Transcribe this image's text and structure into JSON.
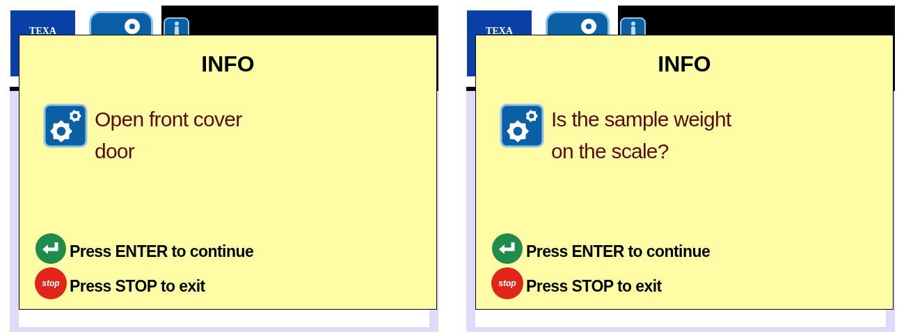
{
  "screens": [
    {
      "logo": "TEXA",
      "dialog": {
        "title": "INFO",
        "message_lines": [
          "Open front cover",
          "door"
        ],
        "hints": [
          {
            "kind": "enter",
            "text": "Press ENTER to continue"
          },
          {
            "kind": "stop",
            "icon_text": "stop",
            "text": "Press STOP to exit"
          }
        ]
      }
    },
    {
      "logo": "TEXA",
      "dialog": {
        "title": "INFO",
        "message_lines": [
          "Is the sample weight",
          "on the scale?"
        ],
        "hints": [
          {
            "kind": "enter",
            "text": "Press ENTER to continue"
          },
          {
            "kind": "stop",
            "icon_text": "stop",
            "text": "Press STOP to exit"
          }
        ]
      }
    }
  ]
}
